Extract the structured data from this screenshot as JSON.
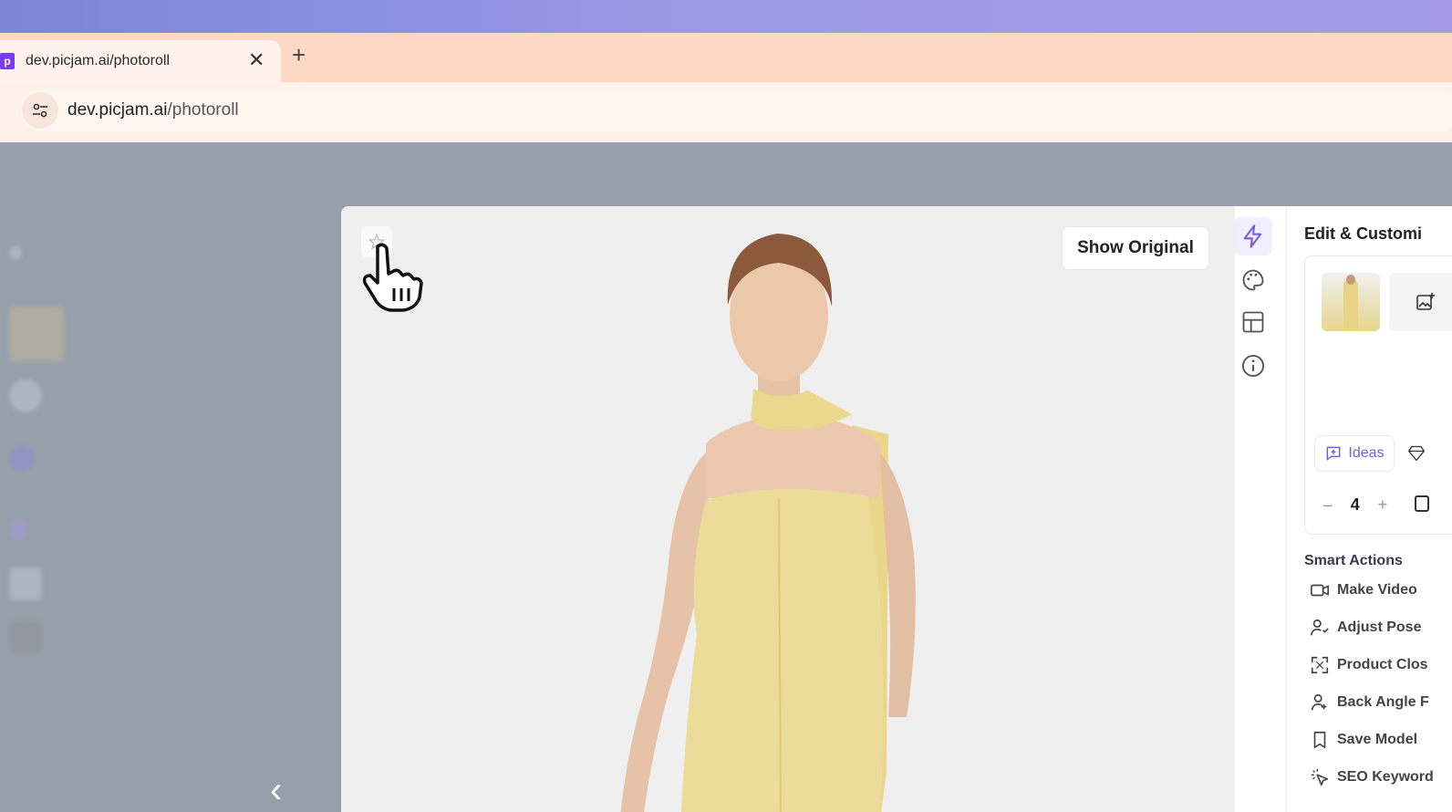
{
  "browser": {
    "tab_title": "dev.picjam.ai/photoroll",
    "tab_favicon": "p",
    "close_glyph": "✕",
    "new_tab_glyph": "+",
    "url_domain": "dev.picjam.ai",
    "url_path": "/photoroll"
  },
  "viewer": {
    "show_original_label": "Show Original",
    "back_glyph": "‹"
  },
  "tools": [
    {
      "icon": "lightning-icon",
      "active": true
    },
    {
      "icon": "palette-icon",
      "active": false
    },
    {
      "icon": "layout-icon",
      "active": false
    },
    {
      "icon": "info-icon",
      "active": false
    }
  ],
  "panel": {
    "title": "Edit & Customi",
    "ideas_label": "Ideas",
    "stepper": {
      "minus": "–",
      "value": "4",
      "plus": "+"
    },
    "smart_actions_title": "Smart Actions",
    "actions": [
      {
        "label": "Make Video",
        "icon": "video-icon"
      },
      {
        "label": "Adjust Pose",
        "icon": "pose-icon"
      },
      {
        "label": "Product Clos",
        "icon": "expand-icon"
      },
      {
        "label": "Back Angle F",
        "icon": "person-icon"
      },
      {
        "label": "Save Model",
        "icon": "bookmark-icon"
      },
      {
        "label": "SEO Keyword",
        "icon": "cursor-click-icon"
      }
    ]
  },
  "colors": {
    "accent": "#7c5cdb",
    "overlay": "#96a0ab",
    "dress": "#ecdc9a"
  }
}
